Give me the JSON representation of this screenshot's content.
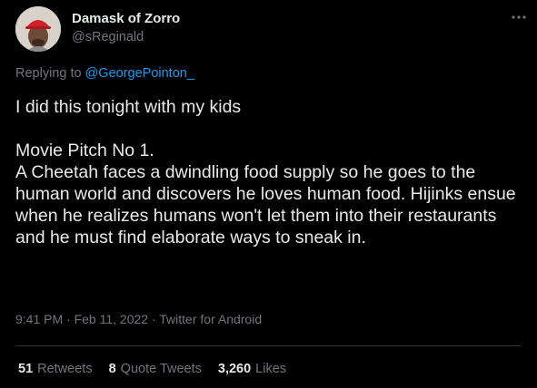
{
  "author": {
    "display_name": "Damask of Zorro",
    "handle": "@sReginald"
  },
  "more_icon": "more-horizontal-icon",
  "reply": {
    "prefix": "Replying to ",
    "to": "@GeorgePointon_"
  },
  "tweet": {
    "line1": "I did this tonight with my kids",
    "line2": "Movie Pitch No 1.",
    "line3": "A Cheetah faces a dwindling food supply so he goes to the human world and discovers he loves human food. Hijinks ensue when he realizes humans won't let them into their restaurants and he must find elaborate ways to sneak in."
  },
  "meta": {
    "time": "9:41 PM",
    "sep1": " · ",
    "date": "Feb 11, 2022",
    "sep2": " · ",
    "source": "Twitter for Android"
  },
  "stats": {
    "retweets_count": "51",
    "retweets_label": "Retweets",
    "quotes_count": "8",
    "quotes_label": "Quote Tweets",
    "likes_count": "3,260",
    "likes_label": "Likes"
  },
  "colors": {
    "background": "#000000",
    "text": "#e7e9ea",
    "secondary": "#71767b",
    "link": "#1d9bf0",
    "divider": "#2f3336"
  }
}
